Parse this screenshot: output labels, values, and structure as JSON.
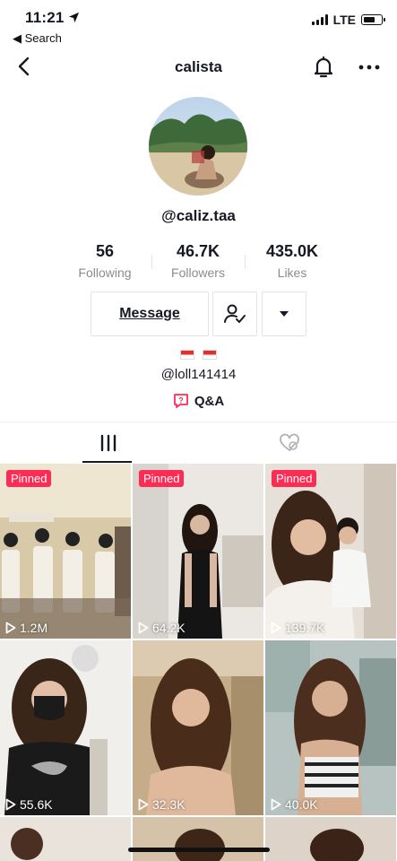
{
  "status_bar": {
    "time": "11:21",
    "back_label": "◀ Search",
    "network": "LTE"
  },
  "nav": {
    "title": "calista"
  },
  "profile": {
    "username": "@caliz.taa",
    "stats": [
      {
        "value": "56",
        "label": "Following"
      },
      {
        "value": "46.7K",
        "label": "Followers"
      },
      {
        "value": "435.0K",
        "label": "Likes"
      }
    ],
    "message_label": "Message",
    "bio_handle": "@loll141414",
    "qa_label": "Q&A"
  },
  "tabs": [
    {
      "icon": "grid-icon"
    },
    {
      "icon": "liked-hidden-icon"
    }
  ],
  "videos": [
    {
      "pinned": "Pinned",
      "views": "1.2M",
      "bg": [
        "#c9b99a",
        "#6a5d4a"
      ]
    },
    {
      "pinned": "Pinned",
      "views": "64.2K",
      "bg": [
        "#ece9e6",
        "#1a1a1a"
      ]
    },
    {
      "pinned": "Pinned",
      "views": "139.7K",
      "bg": [
        "#e8e2da",
        "#7a5a48"
      ]
    },
    {
      "pinned": "",
      "views": "55.6K",
      "bg": [
        "#f2f0ed",
        "#222"
      ]
    },
    {
      "pinned": "",
      "views": "32.3K",
      "bg": [
        "#c8b08a",
        "#4a3020"
      ]
    },
    {
      "pinned": "",
      "views": "40.0K",
      "bg": [
        "#b9c6c4",
        "#6d5040"
      ]
    }
  ],
  "colors": {
    "accent": "#fe2c55",
    "text": "#161823",
    "muted": "#8a8b91"
  }
}
